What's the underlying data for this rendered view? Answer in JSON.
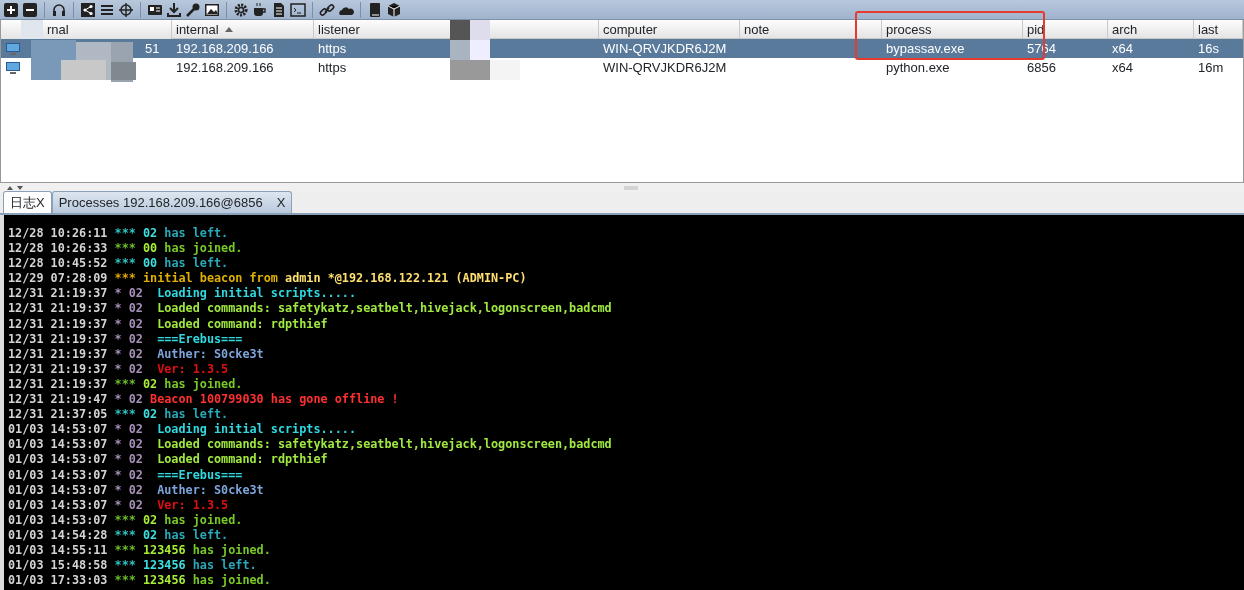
{
  "table": {
    "columns": [
      {
        "label": "rnal",
        "sorted": false
      },
      {
        "label": "internal",
        "sorted": true
      },
      {
        "label": "listener",
        "sorted": false
      },
      {
        "label": "computer",
        "sorted": false
      },
      {
        "label": "note",
        "sorted": false
      },
      {
        "label": "process",
        "sorted": false
      },
      {
        "label": "pid",
        "sorted": false
      },
      {
        "label": "arch",
        "sorted": false
      },
      {
        "label": "last",
        "sorted": false
      }
    ],
    "annotation": {
      "kind": "frame"
    },
    "rows": [
      {
        "selected": true,
        "cells": [
          "51",
          "192.168.209.166",
          "https",
          "WIN-QRVJKDR6J2M",
          "",
          "bypassav.exe",
          "5764",
          "x64",
          "16s"
        ]
      },
      {
        "selected": false,
        "cells": [
          "",
          "192.168.209.166",
          "https",
          "WIN-QRVJKDR6J2M",
          "",
          "python.exe",
          "6856",
          "x64",
          "16m"
        ]
      }
    ]
  },
  "tabs": [
    {
      "label": "日志X",
      "selected": true
    },
    {
      "label": "Processes 192.168.209.166@6856",
      "close": "X",
      "selected": false
    }
  ],
  "log": [
    {
      "time": "12/28 10:26:11",
      "marker": "***",
      "kind": "left",
      "parts": [
        {
          "text": "02",
          "kind": "left_name"
        },
        {
          "text": "has left.",
          "kind": "left_text"
        }
      ]
    },
    {
      "time": "12/28 10:26:33",
      "marker": "***",
      "kind": "joined",
      "parts": [
        {
          "text": "00",
          "kind": "joined_name"
        },
        {
          "text": "has joined.",
          "kind": "joined_text"
        }
      ]
    },
    {
      "time": "12/28 10:45:52",
      "marker": "***",
      "kind": "left",
      "parts": [
        {
          "text": "00",
          "kind": "left_name"
        },
        {
          "text": "has left.",
          "kind": "left_text"
        }
      ]
    },
    {
      "time": "12/29 07:28:09",
      "marker": "***",
      "kind": "beacon",
      "parts": [
        {
          "text": "initial beacon from",
          "kind": "beacon_text"
        },
        {
          "text": "admin",
          "kind": "beacon_user"
        },
        {
          "text": "*@192.168.122.121 (ADMIN-PC)",
          "kind": "beacon_user"
        }
      ]
    },
    {
      "time": "12/31 21:19:37",
      "marker": "* 02",
      "kind": "script",
      "parts": [
        {
          "text": " Loading initial scripts.....",
          "kind": "info"
        }
      ]
    },
    {
      "time": "12/31 21:19:37",
      "marker": "* 02",
      "kind": "script",
      "parts": [
        {
          "text": " Loaded commands: safetykatz,seatbelt,hivejack,logonscreen,badcmd",
          "kind": "command"
        }
      ]
    },
    {
      "time": "12/31 21:19:37",
      "marker": "* 02",
      "kind": "script",
      "parts": [
        {
          "text": " Loaded command: rdpthief",
          "kind": "command"
        }
      ]
    },
    {
      "time": "12/31 21:19:37",
      "marker": "* 02",
      "kind": "script",
      "parts": [
        {
          "text": " ===Erebus===",
          "kind": "info"
        }
      ]
    },
    {
      "time": "12/31 21:19:37",
      "marker": "* 02",
      "kind": "script",
      "parts": [
        {
          "text": " Auther: S0cke3t",
          "kind": "author"
        }
      ]
    },
    {
      "time": "12/31 21:19:37",
      "marker": "* 02",
      "kind": "script",
      "parts": [
        {
          "text": " Ver: 1.3.5",
          "kind": "version"
        }
      ]
    },
    {
      "time": "12/31 21:19:37",
      "marker": "***",
      "kind": "joined",
      "parts": [
        {
          "text": "02",
          "kind": "joined_name"
        },
        {
          "text": "has joined.",
          "kind": "joined_text"
        }
      ]
    },
    {
      "time": "12/31 21:19:47",
      "marker": "* 02",
      "kind": "script",
      "parts": [
        {
          "text": "Beacon 100799030 has gone offline !",
          "kind": "error"
        }
      ]
    },
    {
      "time": "12/31 21:37:05",
      "marker": "***",
      "kind": "left",
      "parts": [
        {
          "text": "02",
          "kind": "left_name"
        },
        {
          "text": "has left.",
          "kind": "left_text"
        }
      ]
    },
    {
      "time": "01/03 14:53:07",
      "marker": "* 02",
      "kind": "script",
      "parts": [
        {
          "text": " Loading initial scripts.....",
          "kind": "info"
        }
      ]
    },
    {
      "time": "01/03 14:53:07",
      "marker": "* 02",
      "kind": "script",
      "parts": [
        {
          "text": " Loaded commands: safetykatz,seatbelt,hivejack,logonscreen,badcmd",
          "kind": "command"
        }
      ]
    },
    {
      "time": "01/03 14:53:07",
      "marker": "* 02",
      "kind": "script",
      "parts": [
        {
          "text": " Loaded command: rdpthief",
          "kind": "command"
        }
      ]
    },
    {
      "time": "01/03 14:53:07",
      "marker": "* 02",
      "kind": "script",
      "parts": [
        {
          "text": " ===Erebus===",
          "kind": "info"
        }
      ]
    },
    {
      "time": "01/03 14:53:07",
      "marker": "* 02",
      "kind": "script",
      "parts": [
        {
          "text": " Auther: S0cke3t",
          "kind": "author"
        }
      ]
    },
    {
      "time": "01/03 14:53:07",
      "marker": "* 02",
      "kind": "script",
      "parts": [
        {
          "text": " Ver: 1.3.5",
          "kind": "version"
        }
      ]
    },
    {
      "time": "01/03 14:53:07",
      "marker": "***",
      "kind": "joined",
      "parts": [
        {
          "text": "02",
          "kind": "joined_name"
        },
        {
          "text": "has joined.",
          "kind": "joined_text"
        }
      ]
    },
    {
      "time": "01/03 14:54:28",
      "marker": "***",
      "kind": "left",
      "parts": [
        {
          "text": "02",
          "kind": "left_name"
        },
        {
          "text": "has left.",
          "kind": "left_text"
        }
      ]
    },
    {
      "time": "01/03 14:55:11",
      "marker": "***",
      "kind": "joined",
      "parts": [
        {
          "text": "123456",
          "kind": "joined_name"
        },
        {
          "text": "has joined.",
          "kind": "joined_text"
        }
      ]
    },
    {
      "time": "01/03 15:48:58",
      "marker": "***",
      "kind": "left",
      "parts": [
        {
          "text": "123456",
          "kind": "left_name"
        },
        {
          "text": "has left.",
          "kind": "left_text"
        }
      ]
    },
    {
      "time": "01/03 17:33:03",
      "marker": "***",
      "kind": "joined",
      "parts": [
        {
          "text": "123456",
          "kind": "joined_name"
        },
        {
          "text": "has joined.",
          "kind": "joined_text"
        }
      ]
    }
  ]
}
